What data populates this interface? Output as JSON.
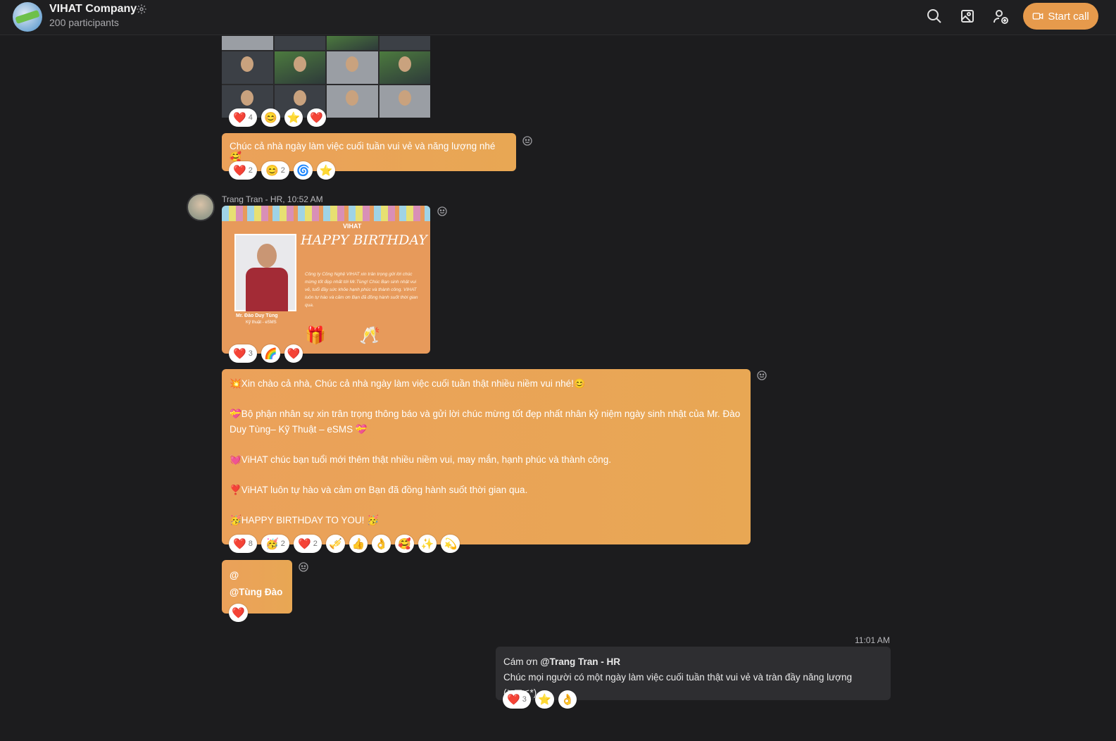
{
  "header": {
    "title": "VIHAT Company",
    "participants": "200 participants",
    "start_call_label": "Start call"
  },
  "messages": {
    "m1": {
      "image_reactions": [
        {
          "emoji": "❤️",
          "count": "4"
        },
        {
          "emoji": "😊",
          "count": ""
        },
        {
          "emoji": "⭐",
          "count": ""
        },
        {
          "emoji": "❤️",
          "count": ""
        }
      ],
      "text": "Chúc cả nhà ngày làm việc cuối tuần vui vẻ và năng lượng nhé 🥰",
      "reactions": [
        {
          "emoji": "❤️",
          "count": "2"
        },
        {
          "emoji": "😊",
          "count": "2"
        },
        {
          "emoji": "🌀",
          "count": ""
        },
        {
          "emoji": "⭐",
          "count": ""
        }
      ]
    },
    "m2": {
      "sender": "Trang Tran - HR, 10:52 AM",
      "card": {
        "brand": "VIHAT",
        "heading": "HAPPY BIRTHDAY",
        "name": "Mr. Đào Duy Tùng",
        "role": "Kỹ thuật - eSMS",
        "body": "Công ty Công Nghệ VIHAT xin trân trọng gửi lời chúc mừng tốt đẹp nhất tới Mr.Tùng! Chúc Bạn sinh nhật vui vẻ, tuổi đầy sức khỏe hạnh phúc và thành công. VIHAT luôn tự hào và cảm ơn Bạn đã đồng hành suốt thời gian qua."
      },
      "card_reactions": [
        {
          "emoji": "❤️",
          "count": "3"
        },
        {
          "emoji": "🌈",
          "count": ""
        },
        {
          "emoji": "❤️",
          "count": ""
        }
      ],
      "paragraphs": [
        "💥Xin chào cả nhà, Chúc cả nhà ngày làm việc cuối tuần thật nhiều niềm vui nhé!😊",
        "💝Bộ phận nhân sự xin trân trọng thông báo và gửi lời chúc mừng tốt đẹp nhất nhân kỷ niệm ngày sinh nhật của Mr. Đào Duy Tùng– Kỹ Thuật – eSMS 💝",
        "💓ViHAT chúc bạn tuổi mới thêm thật nhiều niềm vui, may mắn, hạnh phúc và thành công.",
        "❣️ViHAT luôn tự hào và cảm ơn Bạn đã đồng hành suốt thời gian qua.",
        "🥳HAPPY BIRTHDAY  TO YOU! 🥳"
      ],
      "text_reactions": [
        {
          "emoji": "❤️",
          "count": "8"
        },
        {
          "emoji": "🥳",
          "count": "2"
        },
        {
          "emoji": "❤️",
          "count": "2"
        },
        {
          "emoji": "🎺",
          "count": ""
        },
        {
          "emoji": "👍",
          "count": ""
        },
        {
          "emoji": "👌",
          "count": ""
        },
        {
          "emoji": "🥰",
          "count": ""
        },
        {
          "emoji": "✨",
          "count": ""
        },
        {
          "emoji": "💫",
          "count": ""
        }
      ],
      "mention_line1": "@",
      "mention_line2": "@Tùng Đào",
      "mention_reactions": [
        {
          "emoji": "❤️",
          "count": ""
        }
      ]
    },
    "m3": {
      "time": "11:01 AM",
      "prefix": "Cám ơn ",
      "mention": "@Trang Tran - HR",
      "line2": "Chúc mọi người có một ngày làm việc cuối tuần thật vui vẻ và tràn đầy năng lượng (≧▽≦*)",
      "reactions": [
        {
          "emoji": "❤️",
          "count": "3"
        },
        {
          "emoji": "⭐",
          "count": ""
        },
        {
          "emoji": "👌",
          "count": ""
        }
      ]
    }
  },
  "colors": {
    "background": "#1c1c1e",
    "bubble_orange": "#eba15a",
    "accent_button": "#e69a4c",
    "own_bubble": "#2e2e31"
  }
}
